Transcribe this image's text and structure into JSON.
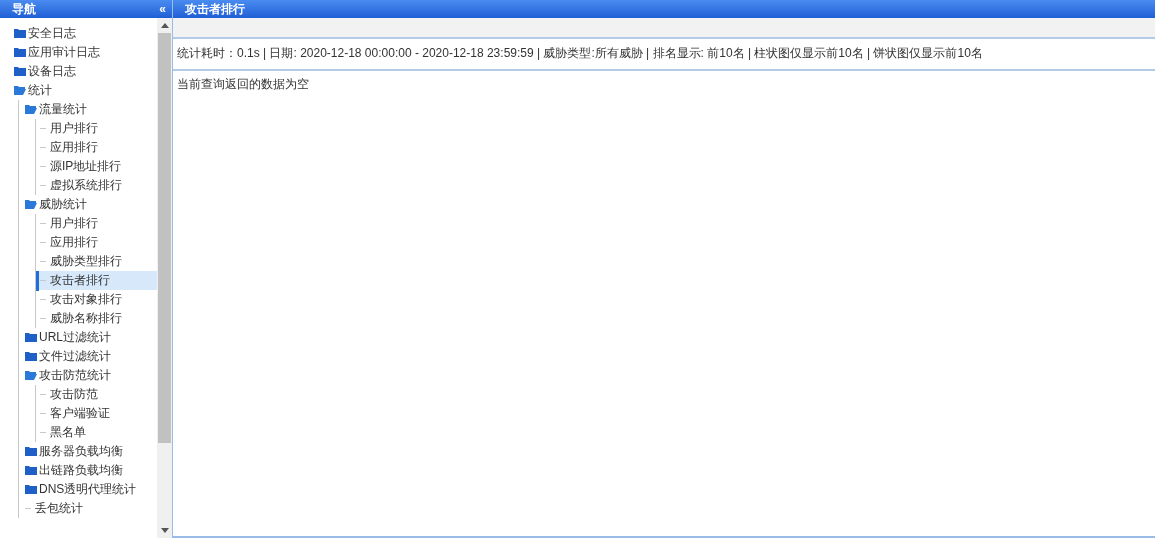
{
  "sidebar": {
    "title": "导航",
    "collapse_glyph": "«",
    "items": [
      {
        "label": "安全日志",
        "kind": "folder",
        "expanded": false,
        "selected": false
      },
      {
        "label": "应用审计日志",
        "kind": "folder",
        "expanded": false,
        "selected": false
      },
      {
        "label": "设备日志",
        "kind": "folder",
        "expanded": false,
        "selected": false
      },
      {
        "label": "统计",
        "kind": "folder",
        "expanded": true,
        "selected": false,
        "children": [
          {
            "label": "流量统计",
            "kind": "folder",
            "expanded": true,
            "selected": false,
            "children": [
              {
                "label": "用户排行",
                "kind": "leaf",
                "selected": false
              },
              {
                "label": "应用排行",
                "kind": "leaf",
                "selected": false
              },
              {
                "label": "源IP地址排行",
                "kind": "leaf",
                "selected": false
              },
              {
                "label": "虚拟系统排行",
                "kind": "leaf",
                "selected": false
              }
            ]
          },
          {
            "label": "威胁统计",
            "kind": "folder",
            "expanded": true,
            "selected": false,
            "children": [
              {
                "label": "用户排行",
                "kind": "leaf",
                "selected": false
              },
              {
                "label": "应用排行",
                "kind": "leaf",
                "selected": false
              },
              {
                "label": "威胁类型排行",
                "kind": "leaf",
                "selected": false
              },
              {
                "label": "攻击者排行",
                "kind": "leaf",
                "selected": true
              },
              {
                "label": "攻击对象排行",
                "kind": "leaf",
                "selected": false
              },
              {
                "label": "威胁名称排行",
                "kind": "leaf",
                "selected": false
              }
            ]
          },
          {
            "label": "URL过滤统计",
            "kind": "folder",
            "expanded": false,
            "selected": false
          },
          {
            "label": "文件过滤统计",
            "kind": "folder",
            "expanded": false,
            "selected": false
          },
          {
            "label": "攻击防范统计",
            "kind": "folder",
            "expanded": true,
            "selected": false,
            "children": [
              {
                "label": "攻击防范",
                "kind": "leaf",
                "selected": false
              },
              {
                "label": "客户端验证",
                "kind": "leaf",
                "selected": false
              },
              {
                "label": "黑名单",
                "kind": "leaf",
                "selected": false
              }
            ]
          },
          {
            "label": "服务器负载均衡",
            "kind": "folder",
            "expanded": false,
            "selected": false
          },
          {
            "label": "出链路负载均衡",
            "kind": "folder",
            "expanded": false,
            "selected": false
          },
          {
            "label": "DNS透明代理统计",
            "kind": "folder",
            "expanded": false,
            "selected": false
          },
          {
            "label": "丢包统计",
            "kind": "leaf",
            "selected": false
          }
        ]
      }
    ]
  },
  "main": {
    "title": "攻击者排行",
    "summary": "统计耗时：0.1s | 日期: 2020-12-18 00:00:00 - 2020-12-18 23:59:59 | 威胁类型:所有威胁 | 排名显示: 前10名 | 柱状图仅显示前10名 | 饼状图仅显示前10名",
    "message": "当前查询返回的数据为空"
  }
}
